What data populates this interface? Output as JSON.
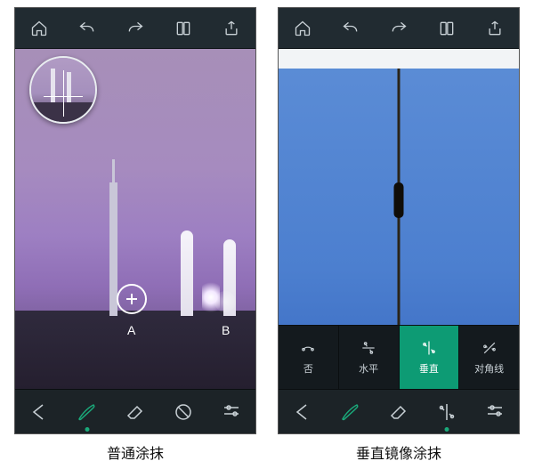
{
  "topbar": {
    "home": "home-icon",
    "undo": "undo-icon",
    "redo": "redo-icon",
    "compare": "compare-icon",
    "share": "share-icon"
  },
  "left": {
    "markerA": "A",
    "markerB": "B",
    "caption": "普通涂抹"
  },
  "right": {
    "options": [
      {
        "key": "none",
        "label": "否",
        "selected": false
      },
      {
        "key": "horizontal",
        "label": "水平",
        "selected": false
      },
      {
        "key": "vertical",
        "label": "垂直",
        "selected": true
      },
      {
        "key": "diagonal",
        "label": "对角线",
        "selected": false
      }
    ],
    "caption": "垂直镜像涂抹"
  },
  "bottombar": {
    "back": "back",
    "brush": "画笔",
    "eraser": "橡皮",
    "mirror": "镜像",
    "settings": "设置"
  }
}
